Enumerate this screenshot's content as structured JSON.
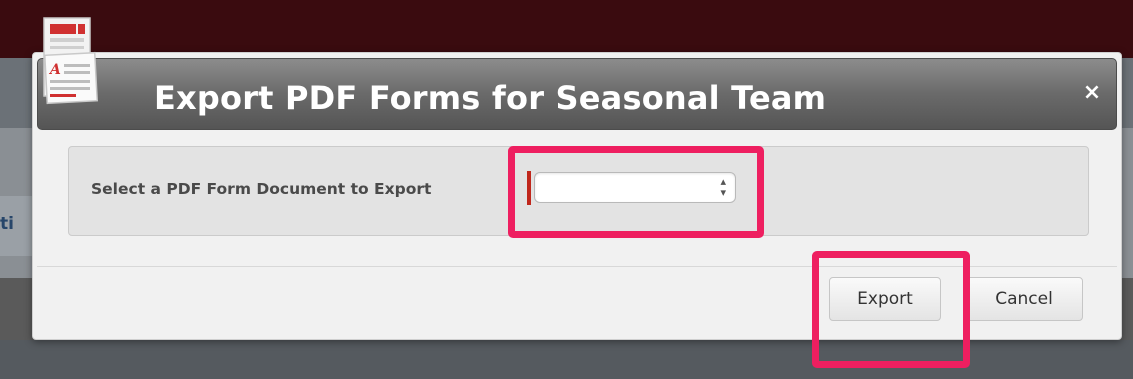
{
  "dialog": {
    "title": "Export PDF Forms for Seasonal Team",
    "close_glyph": "×",
    "header_icon": "pdf-document-icon"
  },
  "form": {
    "select_label": "Select a PDF Form Document to Export",
    "select_value": "",
    "select_arrows": "▴▾",
    "required": true
  },
  "buttons": {
    "export_label": "Export",
    "cancel_label": "Cancel"
  },
  "background": {
    "partial_text": "ti"
  },
  "colors": {
    "highlight": "#ee1f60",
    "required_marker": "#c0271c",
    "header_gradient_top": "#8c8c8c",
    "header_gradient_bottom": "#555555"
  }
}
